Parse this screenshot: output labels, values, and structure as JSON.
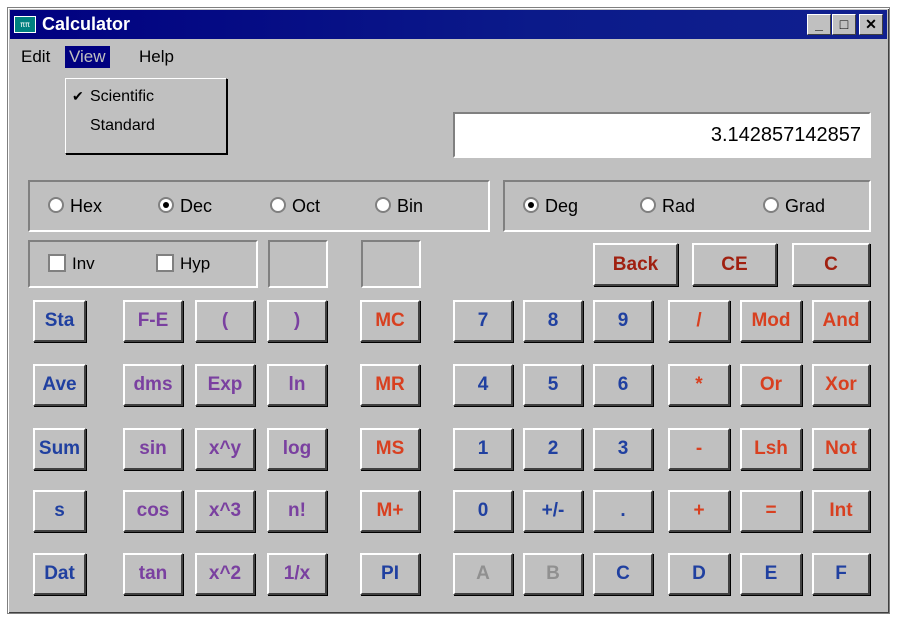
{
  "window": {
    "title": "Calculator",
    "icon_text": "ππ",
    "controls": {
      "minimize": "_",
      "maximize": "□",
      "close": "✕"
    }
  },
  "menubar": {
    "items": [
      "Edit",
      "View",
      "Help"
    ],
    "active": "View"
  },
  "view_menu": {
    "items": [
      {
        "label": "Scientific",
        "checked": true
      },
      {
        "label": "Standard",
        "checked": false
      }
    ]
  },
  "display": {
    "value": "3.142857142857"
  },
  "number_base": {
    "options": [
      "Hex",
      "Dec",
      "Oct",
      "Bin"
    ],
    "selected": "Dec"
  },
  "angle_units": {
    "options": [
      "Deg",
      "Rad",
      "Grad"
    ],
    "selected": "Deg"
  },
  "modifiers": [
    "Inv",
    "Hyp"
  ],
  "edit_buttons": [
    "Back",
    "CE",
    "C"
  ],
  "colors": {
    "stats": "#2040a0",
    "functions": "#7a40a0",
    "memory": "#d84020",
    "digits": "#2040a0",
    "operators": "#d84020",
    "clear": "#a02010",
    "disabled": "#909090"
  },
  "keypad": {
    "stats": [
      "Sta",
      "Ave",
      "Sum",
      "s",
      "Dat"
    ],
    "functions": [
      [
        "F-E",
        "(",
        ")"
      ],
      [
        "dms",
        "Exp",
        "ln"
      ],
      [
        "sin",
        "x^y",
        "log"
      ],
      [
        "cos",
        "x^3",
        "n!"
      ],
      [
        "tan",
        "x^2",
        "1/x"
      ]
    ],
    "memory": [
      "MC",
      "MR",
      "MS",
      "M+",
      "PI"
    ],
    "digits": [
      [
        "7",
        "8",
        "9"
      ],
      [
        "4",
        "5",
        "6"
      ],
      [
        "1",
        "2",
        "3"
      ],
      [
        "0",
        "+/-",
        "."
      ],
      [
        "A",
        "B",
        "C"
      ]
    ],
    "operators": [
      [
        "/",
        "Mod",
        "And"
      ],
      [
        "*",
        "Or",
        "Xor"
      ],
      [
        "-",
        "Lsh",
        "Not"
      ],
      [
        "+",
        "=",
        "Int"
      ],
      [
        "D",
        "E",
        "F"
      ]
    ]
  }
}
